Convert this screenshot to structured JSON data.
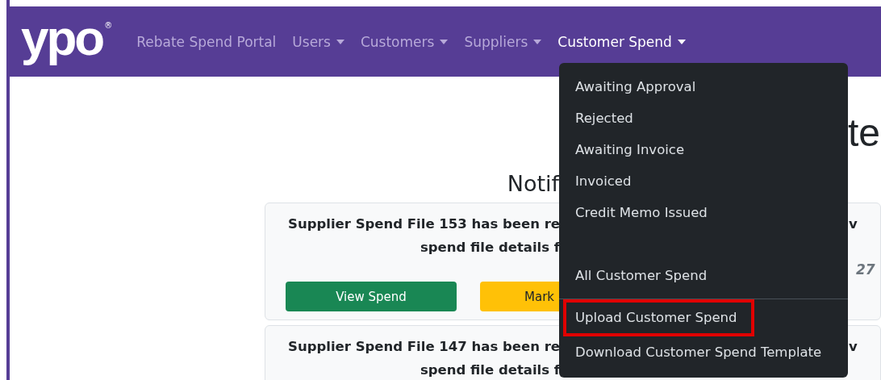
{
  "navbar": {
    "logo": {
      "text": "ypo",
      "mark": "®"
    },
    "links": [
      {
        "label": "Rebate Spend Portal",
        "dropdown": false,
        "selected": false
      },
      {
        "label": "Users",
        "dropdown": true,
        "selected": false
      },
      {
        "label": "Customers",
        "dropdown": true,
        "selected": false
      },
      {
        "label": "Suppliers",
        "dropdown": true,
        "selected": false
      },
      {
        "label": "Customer Spend",
        "dropdown": true,
        "selected": true
      }
    ]
  },
  "page": {
    "title_fragment": "te",
    "notifications_heading_fragment": "Notif",
    "notifications": [
      {
        "line_1": "Supplier Spend File 153 has been re",
        "line_2": "spend file details f",
        "right_fragment": "v",
        "time_fragment": "27",
        "buttons": [
          {
            "label": "View Spend",
            "kind": "success"
          },
          {
            "label": "Mark",
            "kind": "warning"
          }
        ]
      },
      {
        "line_1": "Supplier Spend File 147 has been re",
        "line_2": "spend file details f",
        "right_fragment": "v"
      }
    ]
  },
  "dropdown": {
    "sections": [
      {
        "divider_before": false,
        "items": [
          {
            "label": "Awaiting Approval",
            "highlighted": false
          },
          {
            "label": "Rejected",
            "highlighted": false
          },
          {
            "label": "Awaiting Invoice",
            "highlighted": false
          },
          {
            "label": "Invoiced",
            "highlighted": false
          },
          {
            "label": "Credit Memo Issued",
            "highlighted": false
          }
        ]
      },
      {
        "divider_before": false,
        "items": [
          {
            "label": "All Customer Spend",
            "highlighted": false
          }
        ]
      },
      {
        "divider_before": true,
        "items": [
          {
            "label": "Upload Customer Spend",
            "highlighted": true
          },
          {
            "label": "Download Customer Spend Template",
            "highlighted": false
          }
        ]
      }
    ]
  }
}
